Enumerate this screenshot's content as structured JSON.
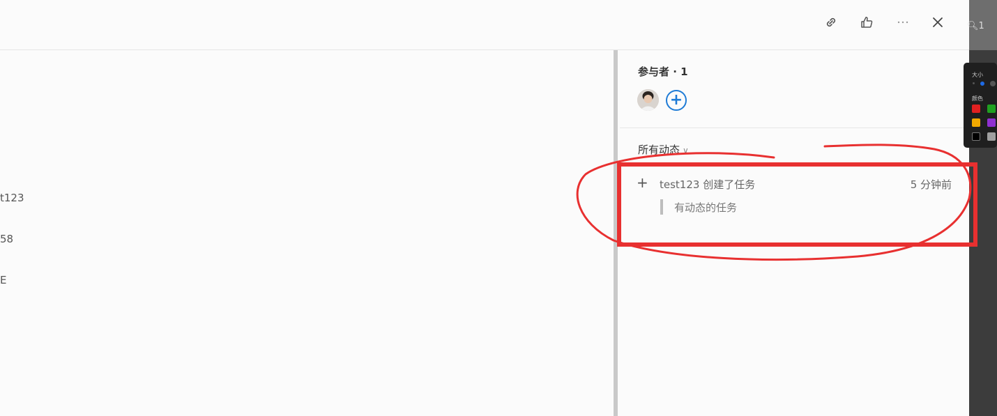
{
  "left": {
    "lines": [
      "t123",
      "58",
      "E"
    ]
  },
  "sidebar": {
    "participants_title": "参与者 · 1",
    "activity_filter": "所有动态",
    "activity_filter_chevron": "∨",
    "activity": {
      "text": "test123 创建了任务",
      "time": "5 分钟前",
      "quote": "有动态的任务"
    }
  },
  "strip": {
    "search_count": "1"
  },
  "palette": {
    "size_label": "大小",
    "color_label": "颜色",
    "swatches": [
      "#e02020",
      "#20a020",
      "#f0a800",
      "#9030d0",
      "#000000",
      "#a0a0a0"
    ]
  },
  "annotation_color": "#e83030",
  "accent": "#1e7bd6"
}
